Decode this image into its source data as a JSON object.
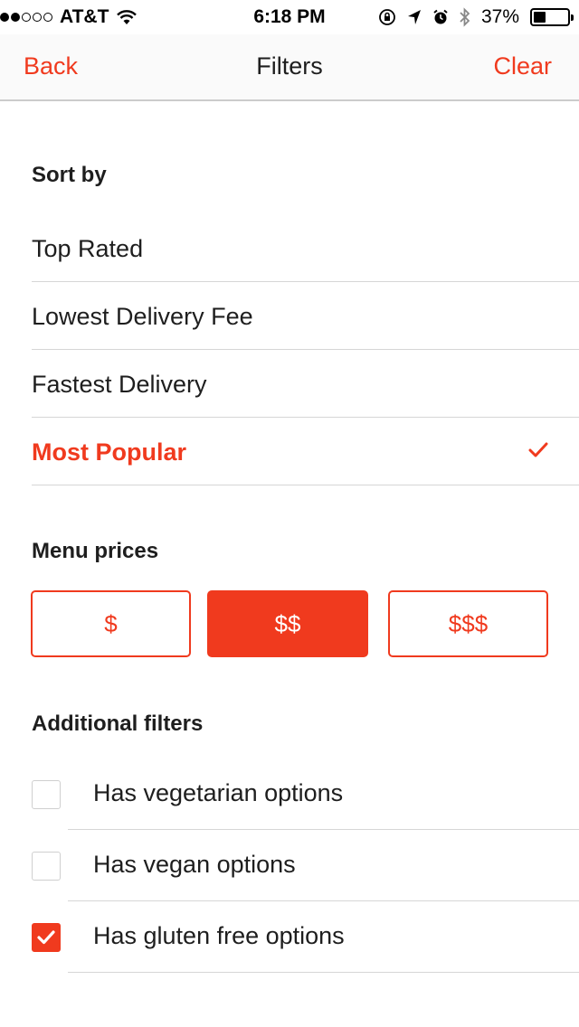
{
  "status_bar": {
    "carrier": "AT&T",
    "time": "6:18 PM",
    "battery": "37%",
    "battery_level": 0.37,
    "icons": [
      "signal-dots-icon",
      "wifi-icon",
      "orientation-lock-icon",
      "location-arrow-icon",
      "alarm-icon",
      "bluetooth-icon",
      "battery-icon"
    ]
  },
  "nav": {
    "back": "Back",
    "title": "Filters",
    "clear": "Clear"
  },
  "sort": {
    "title": "Sort by",
    "options": [
      {
        "label": "Top Rated",
        "selected": false
      },
      {
        "label": "Lowest Delivery Fee",
        "selected": false
      },
      {
        "label": "Fastest Delivery",
        "selected": false
      },
      {
        "label": "Most Popular",
        "selected": true
      }
    ]
  },
  "prices": {
    "title": "Menu prices",
    "options": [
      {
        "label": "$",
        "selected": false
      },
      {
        "label": "$$",
        "selected": true
      },
      {
        "label": "$$$",
        "selected": false
      }
    ]
  },
  "filters": {
    "title": "Additional filters",
    "items": [
      {
        "label": "Has vegetarian options",
        "checked": false
      },
      {
        "label": "Has vegan options",
        "checked": false
      },
      {
        "label": "Has gluten free options",
        "checked": true
      }
    ]
  },
  "colors": {
    "accent": "#f03a1e",
    "text": "#1e1e1e",
    "divider": "#d6d6d6"
  }
}
